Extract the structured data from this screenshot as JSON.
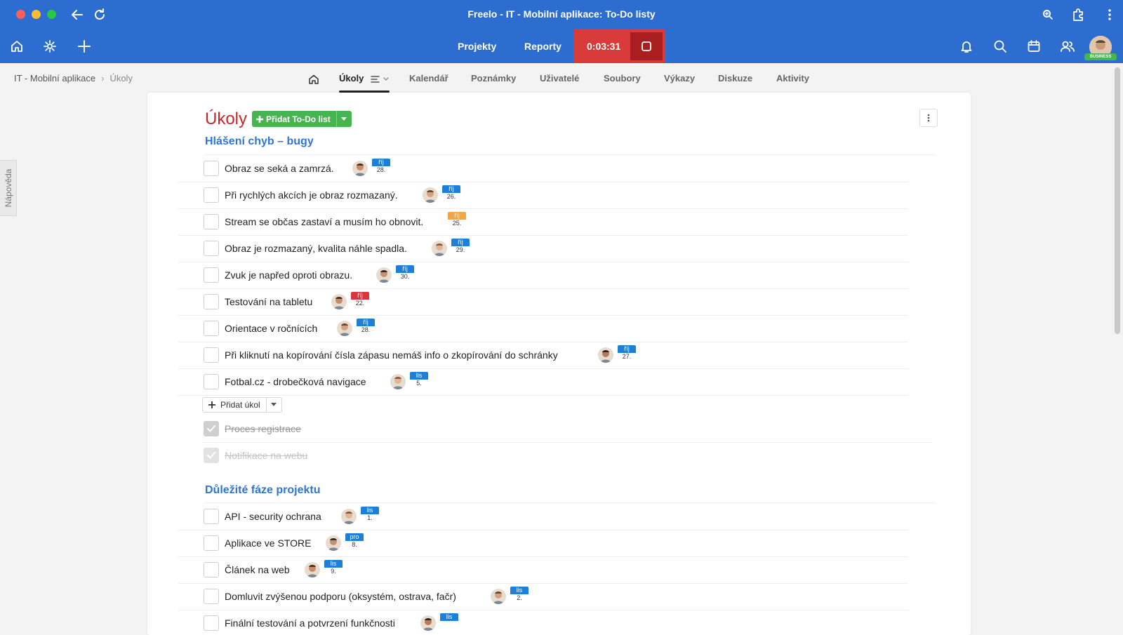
{
  "window": {
    "title": "Freelo - IT - Mobilní aplikace: To-Do listy"
  },
  "topnav": {
    "projects": "Projekty",
    "reports": "Reporty",
    "timer": "0:03:31",
    "user_badge": "BUSINESS"
  },
  "breadcrumb": {
    "project": "IT - Mobilní aplikace",
    "current": "Úkoly"
  },
  "tabs": [
    "Úkoly",
    "Kalendář",
    "Poznámky",
    "Uživatelé",
    "Soubory",
    "Výkazy",
    "Diskuze",
    "Aktivity"
  ],
  "help_tab": "Nápověda",
  "page": {
    "title": "Úkoly",
    "add_list_label": "Přidat To-Do list",
    "add_task_label": "Přidat úkol"
  },
  "lists": [
    {
      "title": "Hlášení chyb – bugy",
      "tasks": [
        {
          "text": "Obraz se seká a zamrzá.",
          "month": "říj",
          "day": "28.",
          "color": "#1f7fd6"
        },
        {
          "text": "Při rychlých akcích je obraz rozmazaný.",
          "month": "říj",
          "day": "26.",
          "color": "#1f7fd6"
        },
        {
          "text": "Stream se občas zastaví a musím ho obnovit.",
          "month": "říj",
          "day": "25.",
          "color": "#f0a54a"
        },
        {
          "text": "Obraz je rozmazaný, kvalita náhle spadla.",
          "month": "říj",
          "day": "29.",
          "color": "#1f7fd6"
        },
        {
          "text": "Zvuk je napřed oproti obrazu.",
          "month": "říj",
          "day": "30.",
          "color": "#1f7fd6"
        },
        {
          "text": "Testování na tabletu",
          "month": "říj",
          "day": "22.",
          "color": "#d9363e"
        },
        {
          "text": "Orientace v ročnících",
          "month": "říj",
          "day": "28.",
          "color": "#1f7fd6"
        },
        {
          "text": "Při kliknutí na kopírování čísla zápasu nemáš info o zkopírování do schránky",
          "month": "říj",
          "day": "27.",
          "color": "#1f7fd6"
        },
        {
          "text": "Fotbal.cz - drobečková navigace",
          "month": "lis",
          "day": "5.",
          "color": "#1f7fd6"
        }
      ],
      "done": [
        "Proces registrace",
        "Notifikace na webu"
      ]
    },
    {
      "title": "Důležité fáze projektu",
      "tasks": [
        {
          "text": "API - security ochrana",
          "month": "lis",
          "day": "1.",
          "color": "#1f7fd6"
        },
        {
          "text": "Aplikace ve STORE",
          "month": "pro",
          "day": "8.",
          "color": "#1f7fd6"
        },
        {
          "text": "Článek na web",
          "month": "lis",
          "day": "9.",
          "color": "#1f7fd6"
        },
        {
          "text": "Domluvit zvýšenou podporu (oksystém, ostrava, fačr)",
          "month": "lis",
          "day": "2.",
          "color": "#1f7fd6"
        },
        {
          "text": "Finální testování a potvrzení funkčnosti",
          "month": "lis",
          "day": "",
          "color": "#1f7fd6"
        }
      ]
    }
  ]
}
